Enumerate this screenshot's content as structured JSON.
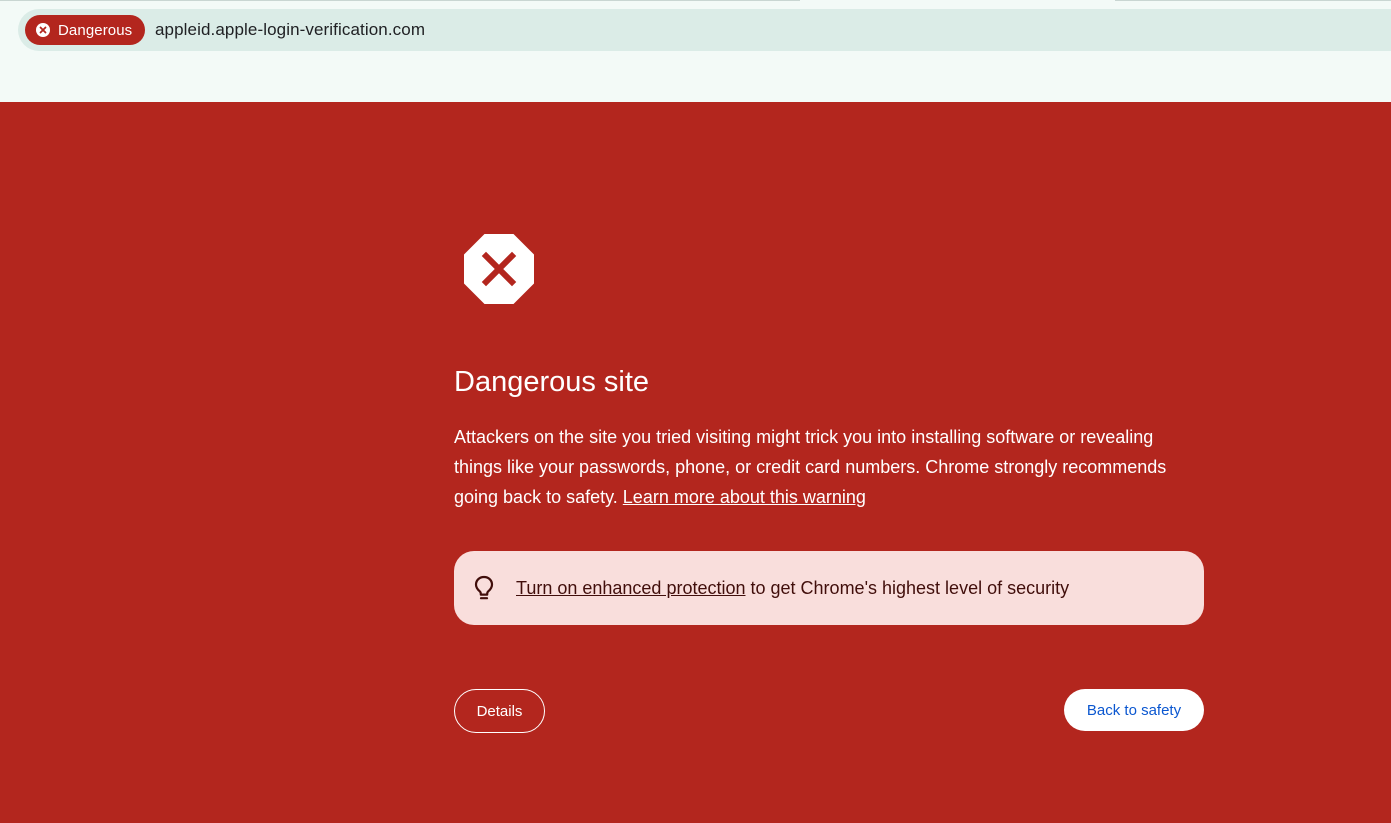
{
  "address_bar": {
    "security_chip_label": "Dangerous",
    "security_chip_icon": "error-x-circle-icon",
    "url": "appleid.apple-login-verification.com"
  },
  "warning": {
    "icon": "stop-octagon-x-icon",
    "title": "Dangerous site",
    "body": "Attackers on the site you tried visiting might trick you into installing software or revealing things like your passwords, phone, or credit card numbers. Chrome strongly recommends going back to safety.",
    "learn_more_link": "Learn more about this warning"
  },
  "enhanced_protection_tip": {
    "icon": "lightbulb-icon",
    "link_text": "Turn on enhanced protection",
    "suffix_text": "to get Chrome's highest level of security"
  },
  "buttons": {
    "details": "Details",
    "back_to_safety": "Back to safety"
  },
  "colors": {
    "danger_red": "#b3261e",
    "chrome_bg": "#f3faf7",
    "omnibox_bg": "#dbece7",
    "tip_bg": "#f9dedc",
    "link_blue": "#0b57d0"
  }
}
